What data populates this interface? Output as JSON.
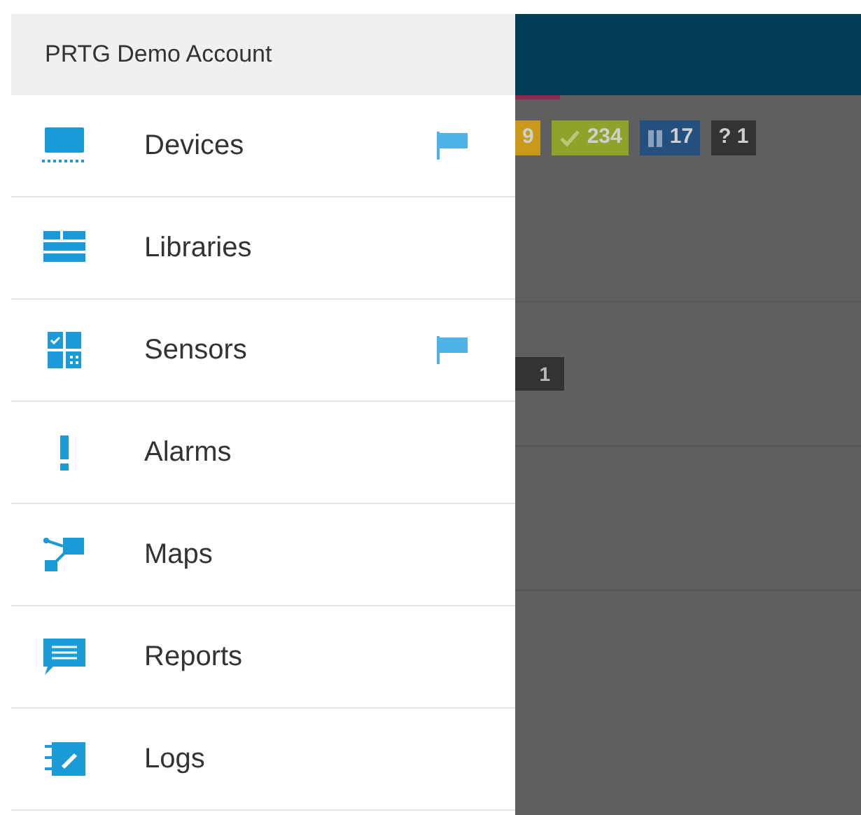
{
  "drawer": {
    "account": "PRTG Demo Account",
    "items": [
      {
        "kind": "devices",
        "label": "Devices",
        "flagged": true
      },
      {
        "kind": "libraries",
        "label": "Libraries",
        "flagged": false
      },
      {
        "kind": "sensors",
        "label": "Sensors",
        "flagged": true
      },
      {
        "kind": "alarms",
        "label": "Alarms",
        "flagged": false
      },
      {
        "kind": "maps",
        "label": "Maps",
        "flagged": false
      },
      {
        "kind": "reports",
        "label": "Reports",
        "flagged": false
      },
      {
        "kind": "logs",
        "label": "Logs",
        "flagged": false
      }
    ]
  },
  "background": {
    "status_badges": [
      {
        "kind": "warning",
        "text": "9"
      },
      {
        "kind": "up",
        "text": "234"
      },
      {
        "kind": "paused",
        "text": "17"
      },
      {
        "kind": "unknown",
        "text": "? 1"
      }
    ],
    "row_badge": {
      "kind": "unknown",
      "text": "1"
    }
  }
}
